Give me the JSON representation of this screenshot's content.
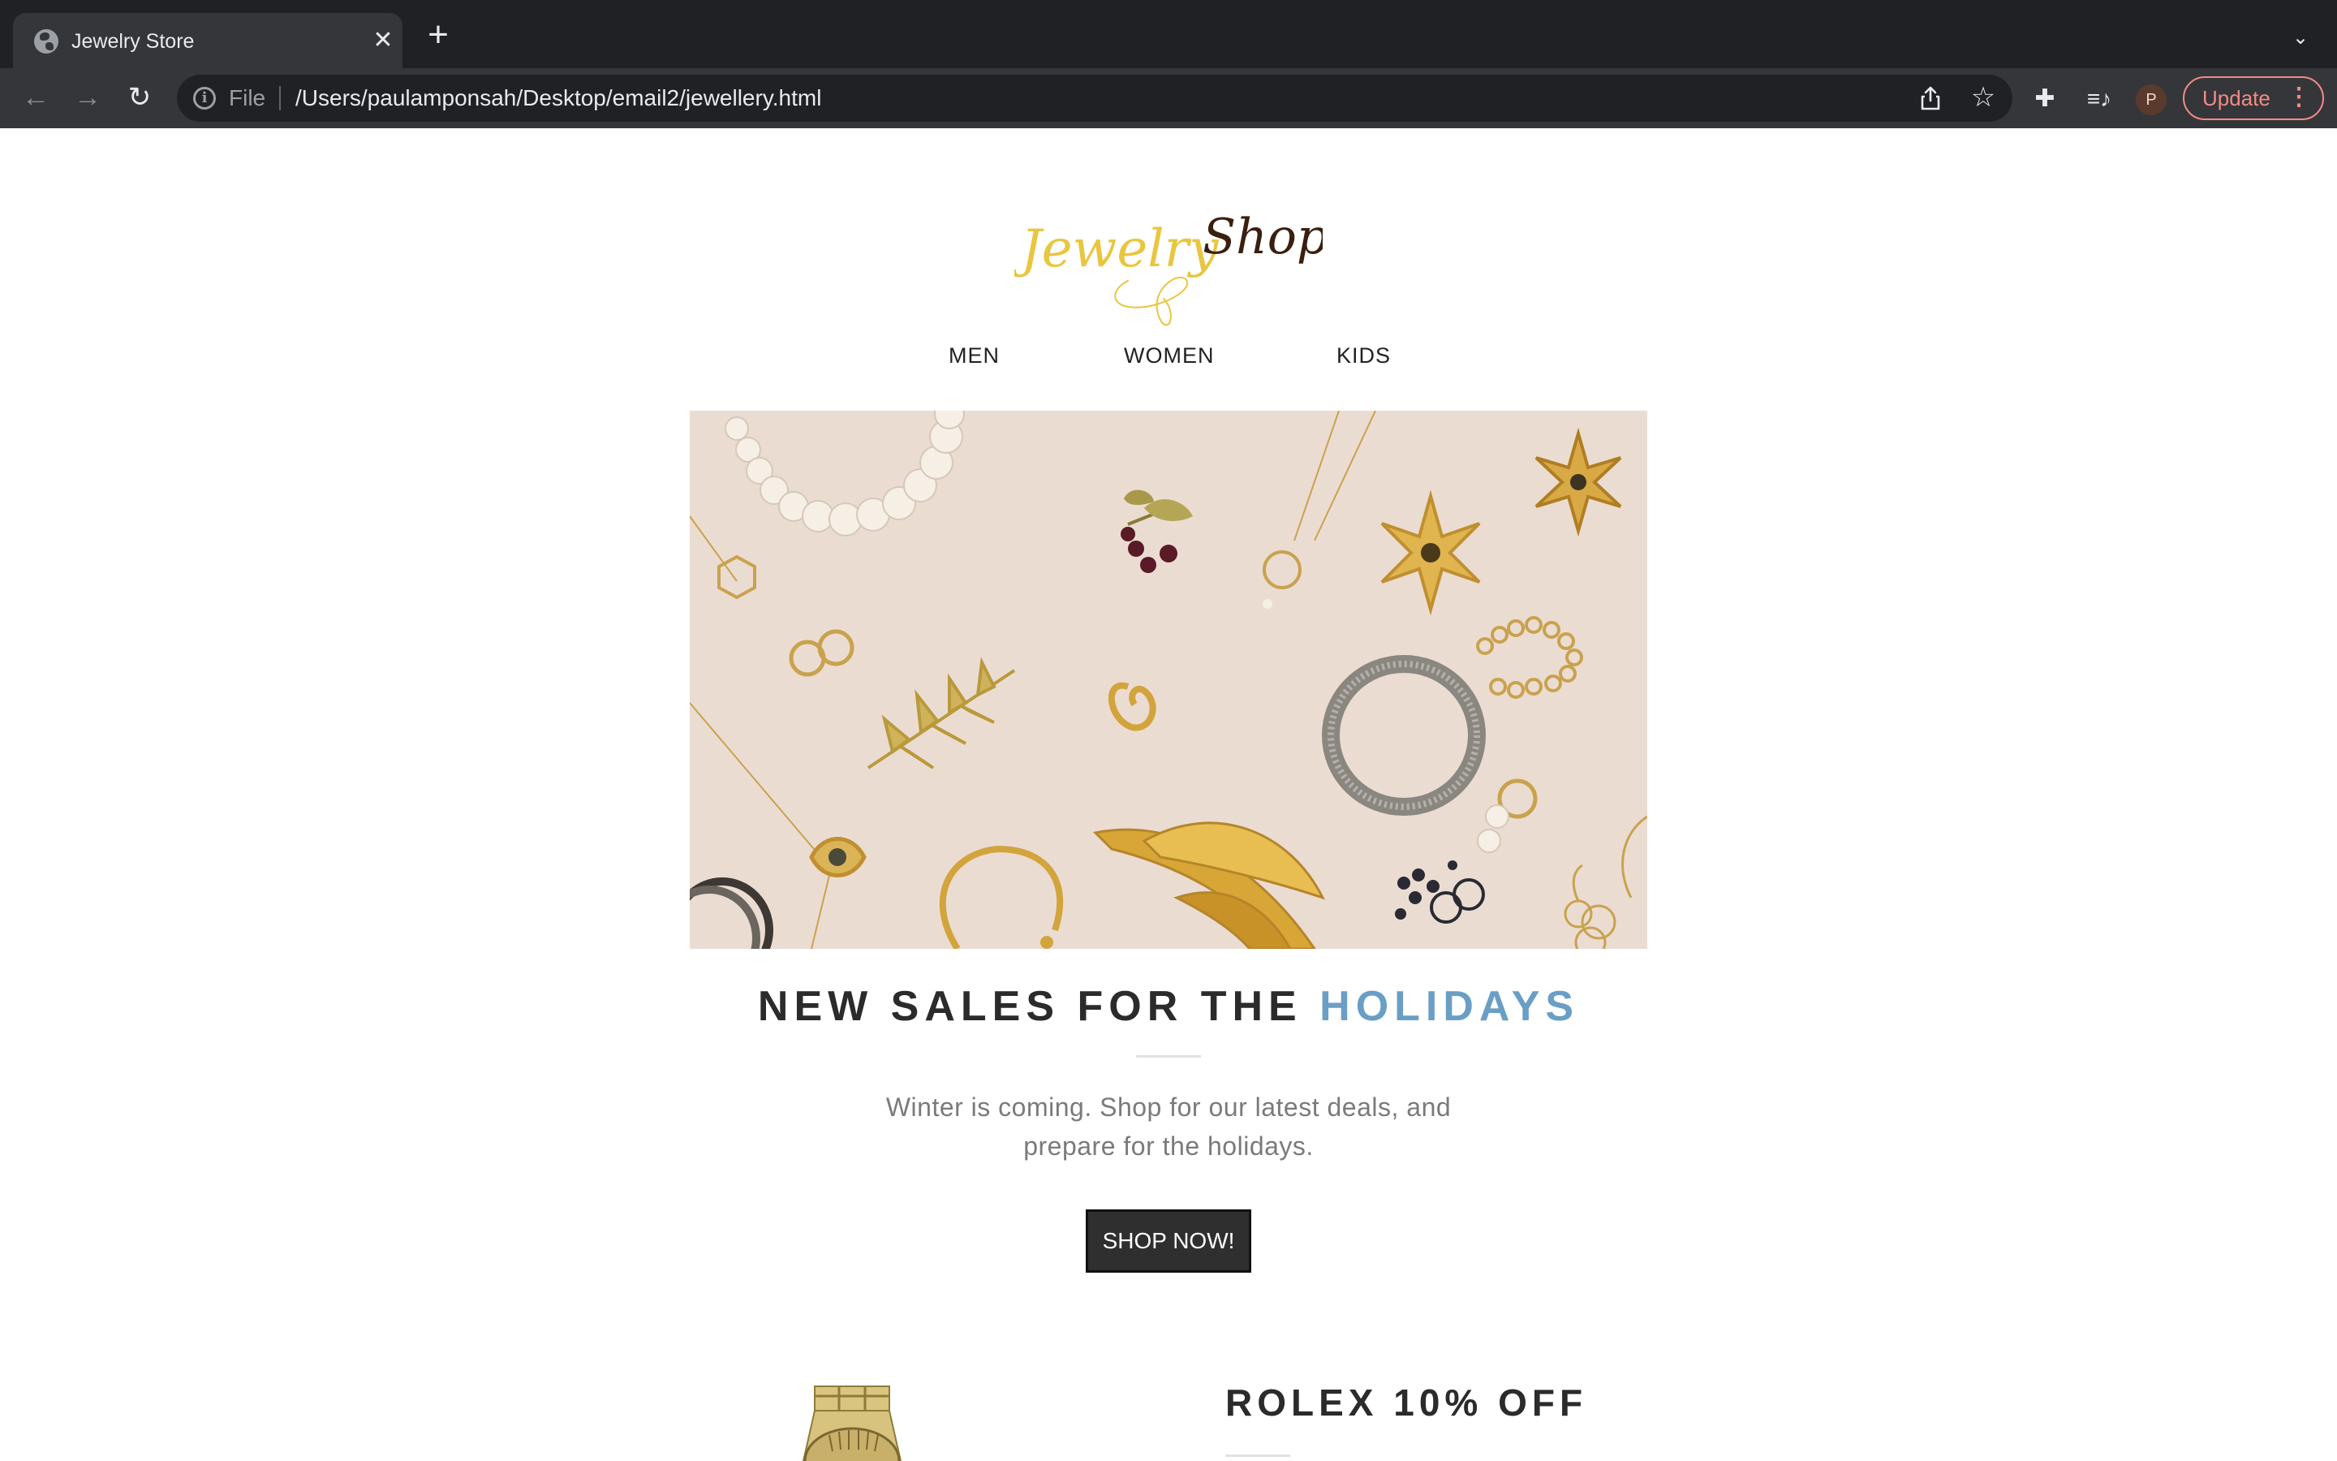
{
  "browser": {
    "tab_title": "Jewelry Store",
    "tab_close": "✕",
    "new_tab": "+",
    "tab_search": "⌄",
    "back": "←",
    "forward": "→",
    "reload": "↻",
    "info": "i",
    "scheme": "File",
    "url": "/Users/paulamponsah/Desktop/email2/jewellery.html",
    "star": "☆",
    "extensions": "✚",
    "media": "≡♪",
    "avatar_initial": "P",
    "update_label": "Update",
    "menu_dots": "⋮"
  },
  "page": {
    "logo_text_1": "Jewelry",
    "logo_text_2": "Shop",
    "nav": [
      "MEN",
      "WOMEN",
      "KIDS"
    ],
    "headline_main": "NEW SALES FOR THE ",
    "headline_accent": "HOLIDAYS",
    "subtext": "Winter is coming. Shop for our latest deals, and prepare for the holidays.",
    "cta": "SHOP NOW!",
    "promo_title": "ROLEX 10% OFF"
  },
  "colors": {
    "accent_blue": "#6a9ec5",
    "logo_gold": "#e9c640",
    "logo_brown": "#3a1f0f",
    "button_dark": "#2f2f2f",
    "hero_bg": "#ebdcd2"
  }
}
